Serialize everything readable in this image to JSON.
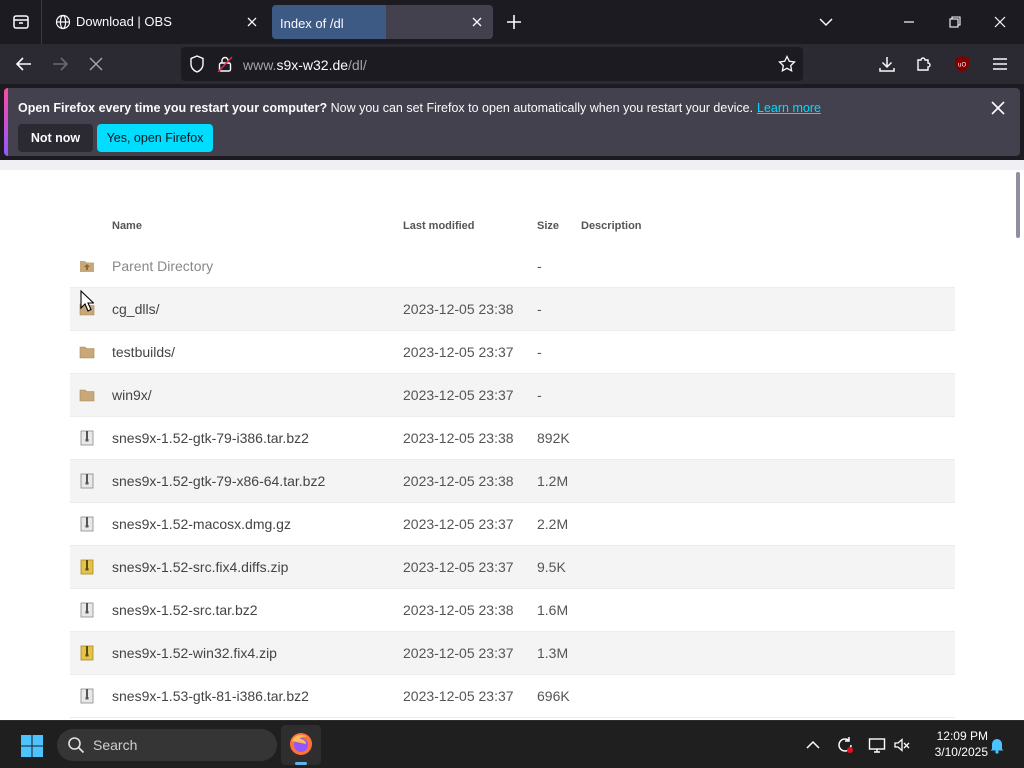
{
  "tabs": [
    {
      "title": "Download | OBS",
      "active": false
    },
    {
      "title": "Index of /dl",
      "active": true
    }
  ],
  "url": {
    "host": "www.",
    "domain": "s9x-w32.de",
    "path": "/dl/"
  },
  "notification": {
    "bold": "Open Firefox every time you restart your computer?",
    "text": " Now you can set Firefox to open automatically when you restart your device.",
    "link": "Learn more",
    "not_now": "Not now",
    "yes": "Yes, open Firefox"
  },
  "listing": {
    "headers": {
      "name": "Name",
      "modified": "Last modified",
      "size": "Size",
      "description": "Description"
    },
    "rows": [
      {
        "icon": "parent-folder",
        "name": "Parent Directory",
        "date": "",
        "size": "-"
      },
      {
        "icon": "folder",
        "name": "cg_dlls/",
        "date": "2023-12-05 23:38",
        "size": "-"
      },
      {
        "icon": "folder",
        "name": "testbuilds/",
        "date": "2023-12-05 23:37",
        "size": "-"
      },
      {
        "icon": "folder",
        "name": "win9x/",
        "date": "2023-12-05 23:37",
        "size": "-"
      },
      {
        "icon": "archive",
        "name": "snes9x-1.52-gtk-79-i386.tar.bz2",
        "date": "2023-12-05 23:38",
        "size": "892K"
      },
      {
        "icon": "archive",
        "name": "snes9x-1.52-gtk-79-x86-64.tar.bz2",
        "date": "2023-12-05 23:38",
        "size": "1.2M"
      },
      {
        "icon": "archive",
        "name": "snes9x-1.52-macosx.dmg.gz",
        "date": "2023-12-05 23:37",
        "size": "2.2M"
      },
      {
        "icon": "zip",
        "name": "snes9x-1.52-src.fix4.diffs.zip",
        "date": "2023-12-05 23:37",
        "size": "9.5K"
      },
      {
        "icon": "archive",
        "name": "snes9x-1.52-src.tar.bz2",
        "date": "2023-12-05 23:38",
        "size": "1.6M"
      },
      {
        "icon": "zip",
        "name": "snes9x-1.52-win32.fix4.zip",
        "date": "2023-12-05 23:37",
        "size": "1.3M"
      },
      {
        "icon": "archive",
        "name": "snes9x-1.53-gtk-81-i386.tar.bz2",
        "date": "2023-12-05 23:37",
        "size": "696K"
      }
    ]
  },
  "taskbar": {
    "search_label": "Search",
    "time": "12:09 PM",
    "date": "3/10/2025"
  },
  "colors": {
    "accent": "#00ddff",
    "tab_active": "#42414d",
    "folder": "#c8a878"
  }
}
